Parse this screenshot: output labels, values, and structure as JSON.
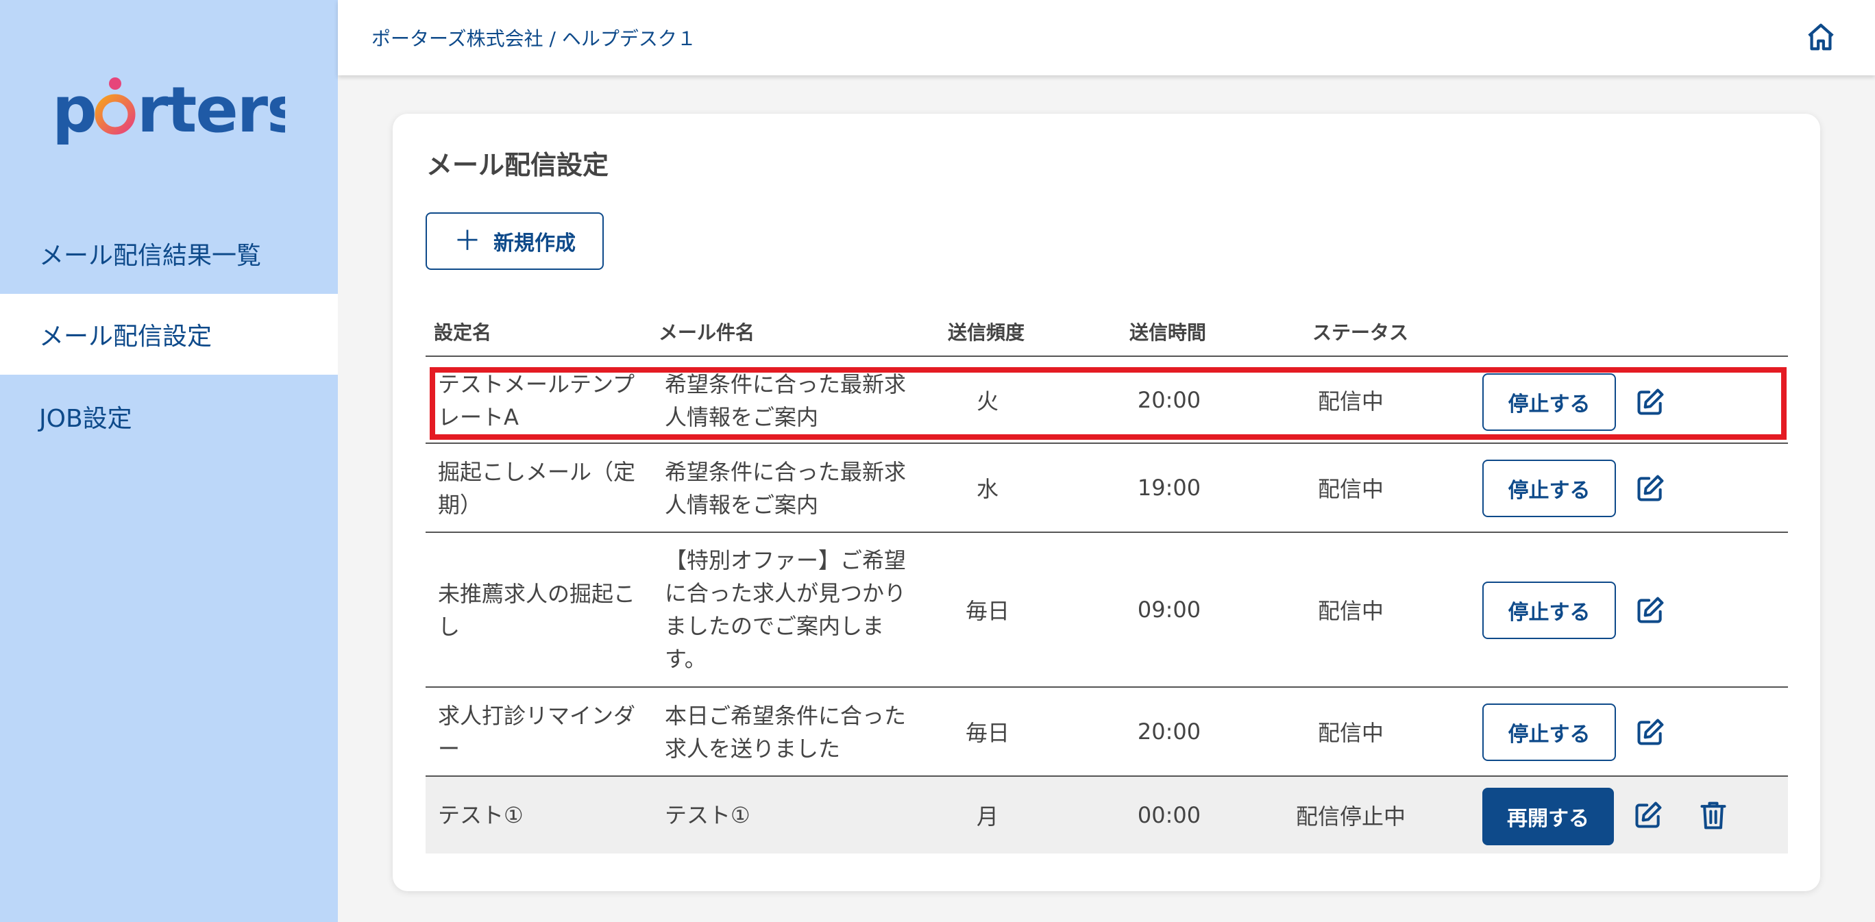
{
  "sidebar": {
    "logo_text": "porters",
    "items": [
      {
        "label": "メール配信結果一覧",
        "active": false
      },
      {
        "label": "メール配信設定",
        "active": true
      },
      {
        "label": "JOB設定",
        "active": false
      }
    ]
  },
  "header": {
    "breadcrumb": "ポーターズ株式会社 / ヘルプデスク１",
    "home_icon": "home-icon"
  },
  "main": {
    "title": "メール配信設定",
    "new_button_label": "新規作成",
    "table": {
      "columns": [
        "設定名",
        "メール件名",
        "送信頻度",
        "送信時間",
        "ステータス"
      ],
      "rows": [
        {
          "name_lines": [
            "テストメールテンプ",
            "レートA"
          ],
          "subject_lines": [
            "希望条件に合った最新求",
            "人情報をご案内"
          ],
          "frequency": "火",
          "time": "20:00",
          "status": "配信中",
          "action": "停止する",
          "highlighted": true
        },
        {
          "name_lines": [
            "掘起こしメール（定",
            "期）"
          ],
          "subject_lines": [
            "希望条件に合った最新求",
            "人情報をご案内"
          ],
          "frequency": "水",
          "time": "19:00",
          "status": "配信中",
          "action": "停止する"
        },
        {
          "name_lines": [
            "未推薦求人の掘起こ",
            "し"
          ],
          "subject_lines": [
            "【特別オファー】ご希望",
            "に合った求人が見つかり",
            "ましたのでご案内しま",
            "す。"
          ],
          "frequency": "毎日",
          "time": "09:00",
          "status": "配信中",
          "action": "停止する"
        },
        {
          "name_lines": [
            "求人打診リマインダ",
            "ー"
          ],
          "subject_lines": [
            "本日ご希望条件に合った",
            "求人を送りました"
          ],
          "frequency": "毎日",
          "time": "20:00",
          "status": "配信中",
          "action": "停止する"
        },
        {
          "name_lines": [
            "テスト①"
          ],
          "subject_lines": [
            "テスト①"
          ],
          "frequency": "月",
          "time": "00:00",
          "status": "配信停止中",
          "action": "再開する",
          "stopped": true
        }
      ]
    }
  },
  "colors": {
    "brand_blue": "#0e4a8a",
    "sidebar_bg": "#bcd7f9",
    "highlight_red": "#e41b23",
    "logo_orange": "#f5a020",
    "logo_pink": "#e6457a"
  }
}
